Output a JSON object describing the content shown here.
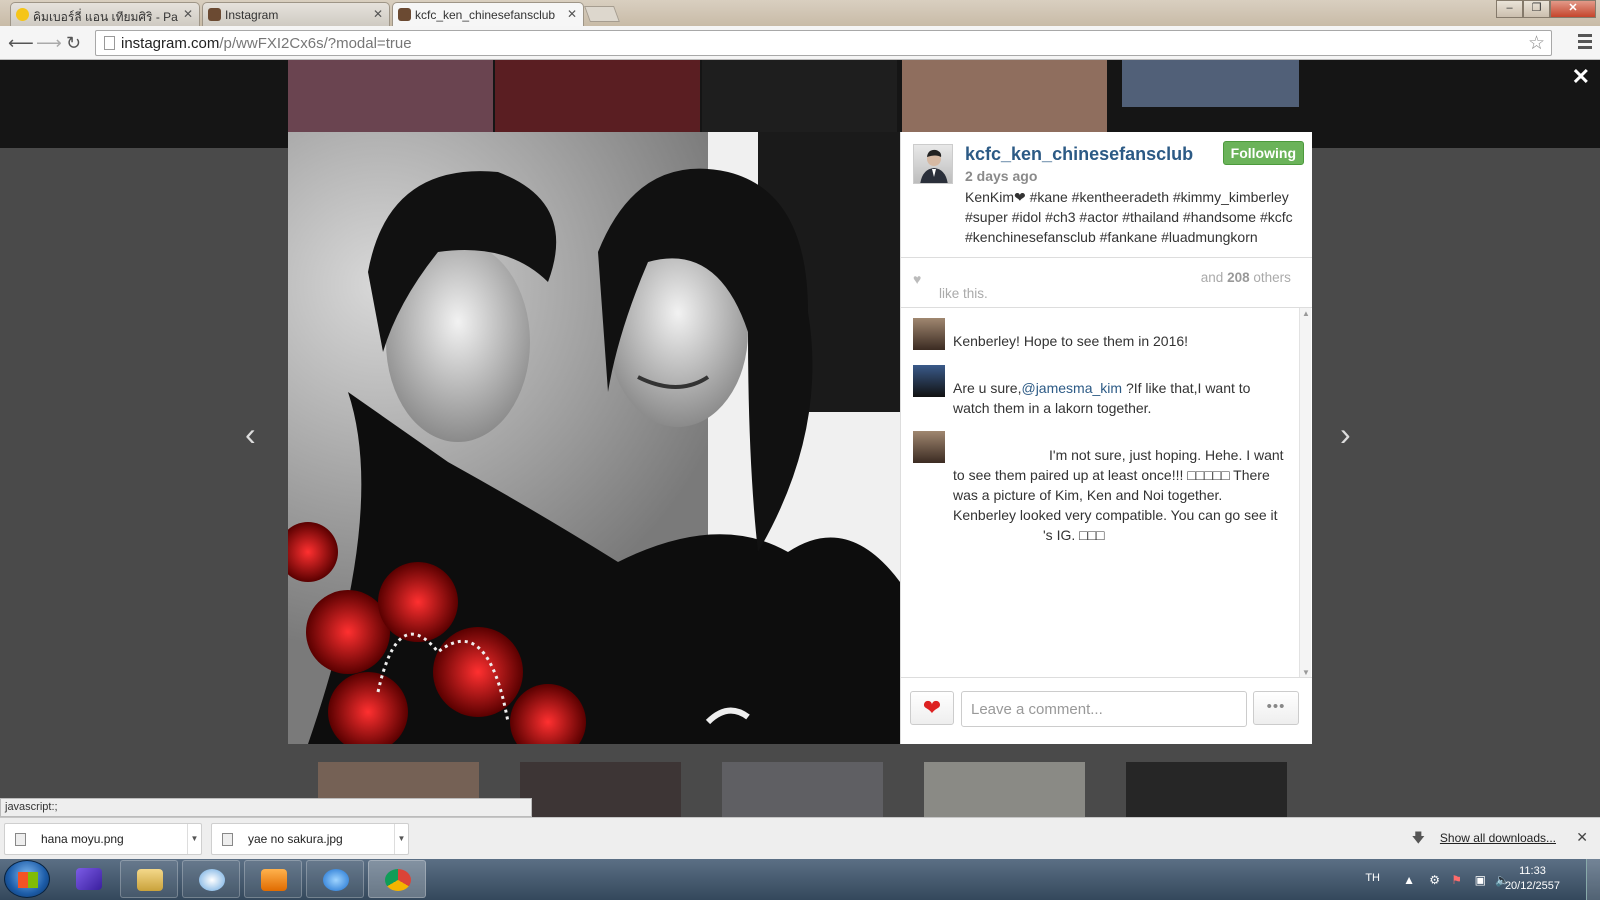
{
  "browser": {
    "tabs": [
      {
        "title": "คิมเบอร์ลี่ แอน เทียมศิริ - Pa"
      },
      {
        "title": "Instagram"
      },
      {
        "title": "kcfc_ken_chinesefansclub"
      }
    ],
    "url_host": "instagram.com",
    "url_path": "/p/wwFXI2Cx6s/?modal=true",
    "status_text": "javascript:;"
  },
  "post": {
    "username": "kcfc_ken_chinesefansclub",
    "follow_label": "Following",
    "time_ago": "2 days ago",
    "caption": "KenKim❤ #kane #kentheeradeth #kimmy_kimberley #super #idol #ch3 #actor #thailand #handsome #kcfc #kenchinesefansclub #fankane #luadmungkorn",
    "likes_prefix": "and",
    "likes_count": "208",
    "likes_suffix": "others",
    "likes_tail": "like this."
  },
  "comments": [
    {
      "text": "Kenberley! Hope to see them in 2016!"
    },
    {
      "text_before": "Are u sure,",
      "mention": "@jamesma_kim",
      "text_after": " ?If like that,I want to watch them in a lakorn together."
    },
    {
      "text": "I'm not sure, just hoping. Hehe. I want to see them paired up at least once!!! □□□□□ There was a picture of Kim, Ken and Noi together. Kenberley looked very compatible. You can go see it",
      "text_end": "'s IG. □□□"
    }
  ],
  "composer": {
    "placeholder": "Leave a comment...",
    "more_label": "•••"
  },
  "downloads": {
    "items": [
      {
        "name": "hana moyu.png"
      },
      {
        "name": "yae no sakura.jpg"
      }
    ],
    "show_all": "Show all downloads..."
  },
  "taskbar": {
    "lang": "TH",
    "time": "11:33",
    "date": "20/12/2557"
  }
}
